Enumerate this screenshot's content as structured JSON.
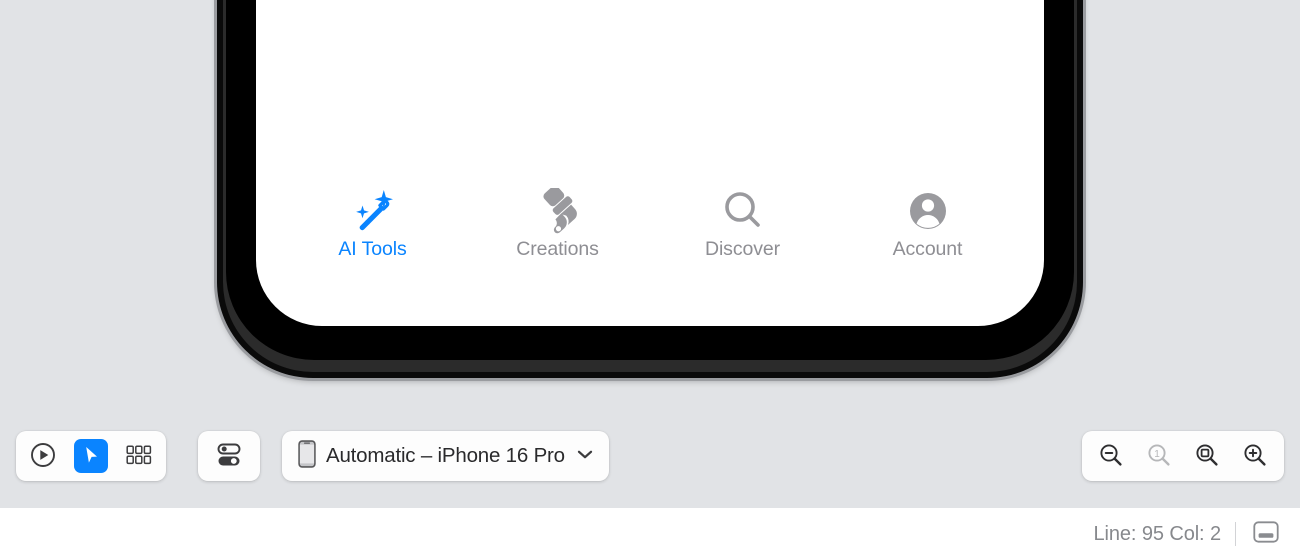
{
  "canvas": {
    "background_color": "#e1e3e6"
  },
  "device_preview": {
    "screen_background": "#ffffff",
    "bezel_color": "#000000",
    "tabbar": {
      "active_color": "#0a84ff",
      "inactive_color": "#8e8e93",
      "items": [
        {
          "label": "AI Tools",
          "icon": "magic-wand-icon",
          "active": true
        },
        {
          "label": "Creations",
          "icon": "paintbrush-icon",
          "active": false
        },
        {
          "label": "Discover",
          "icon": "magnifier-icon",
          "active": false
        },
        {
          "label": "Account",
          "icon": "person-circle-icon",
          "active": false
        }
      ]
    }
  },
  "toolbar": {
    "left_group": [
      {
        "name": "live-preview-button",
        "icon": "play-circle-icon",
        "selected": false
      },
      {
        "name": "select-tool-button",
        "icon": "cursor-arrow-icon",
        "selected": true
      },
      {
        "name": "variants-button",
        "icon": "grid-icon",
        "selected": false
      }
    ],
    "toggles_button": {
      "name": "device-settings-button",
      "icon": "switches-icon"
    },
    "device_selector": {
      "icon": "iphone-icon",
      "value": "Automatic – iPhone 16 Pro",
      "chevron": "chevron-down-icon"
    },
    "zoom_group": [
      {
        "name": "zoom-out-button",
        "icon": "magnifier-minus-icon",
        "label": "",
        "enabled": true
      },
      {
        "name": "zoom-actual-button",
        "icon": "magnifier-one-icon",
        "label": "1",
        "enabled": false
      },
      {
        "name": "zoom-to-fit-button",
        "icon": "magnifier-fit-icon",
        "label": "",
        "enabled": true
      },
      {
        "name": "zoom-in-button",
        "icon": "magnifier-plus-icon",
        "label": "",
        "enabled": true
      }
    ]
  },
  "status_bar": {
    "position": "Line: 95  Col: 2",
    "panel_toggle_icon": "bottom-panel-icon"
  }
}
